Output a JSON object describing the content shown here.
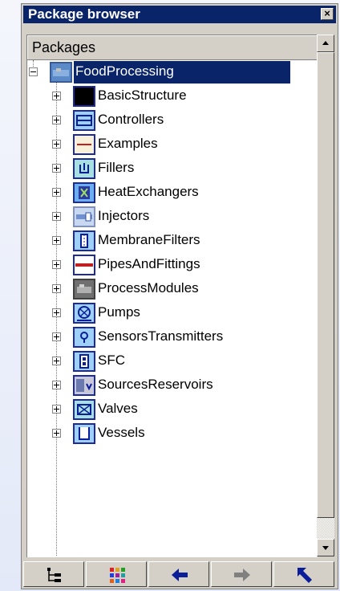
{
  "window": {
    "title": "Package browser",
    "close_glyph": "×"
  },
  "tree": {
    "header": "Packages",
    "root": {
      "label": "FoodProcessing",
      "icon": "food-processing-icon",
      "selected": true
    },
    "items": [
      {
        "label": "BasicStructure",
        "icon": "basic-structure-icon"
      },
      {
        "label": "Controllers",
        "icon": "controllers-icon"
      },
      {
        "label": "Examples",
        "icon": "examples-icon"
      },
      {
        "label": "Fillers",
        "icon": "fillers-icon"
      },
      {
        "label": "HeatExchangers",
        "icon": "heat-exchangers-icon"
      },
      {
        "label": "Injectors",
        "icon": "injectors-icon"
      },
      {
        "label": "MembraneFilters",
        "icon": "membrane-filters-icon"
      },
      {
        "label": "PipesAndFittings",
        "icon": "pipes-and-fittings-icon"
      },
      {
        "label": "ProcessModules",
        "icon": "process-modules-icon"
      },
      {
        "label": "Pumps",
        "icon": "pumps-icon"
      },
      {
        "label": "SensorsTransmitters",
        "icon": "sensors-transmitters-icon"
      },
      {
        "label": "SFC",
        "icon": "sfc-icon"
      },
      {
        "label": "SourcesReservoirs",
        "icon": "sources-reservoirs-icon"
      },
      {
        "label": "Valves",
        "icon": "valves-icon"
      },
      {
        "label": "Vessels",
        "icon": "vessels-icon"
      }
    ]
  },
  "toolbar": {
    "buttons": [
      {
        "name": "tree-view-button",
        "icon": "tree-view-icon"
      },
      {
        "name": "grid-view-button",
        "icon": "grid-view-icon"
      },
      {
        "name": "back-button",
        "icon": "arrow-left-icon"
      },
      {
        "name": "forward-button",
        "icon": "arrow-right-icon"
      },
      {
        "name": "up-button",
        "icon": "arrow-up-left-icon"
      }
    ]
  },
  "colors": {
    "title_bar": "#0a246a",
    "selection": "#0a246a",
    "face": "#d4d0c8",
    "icon_border": "#1c2a9a",
    "icon_fill": "#9fd0f8"
  }
}
